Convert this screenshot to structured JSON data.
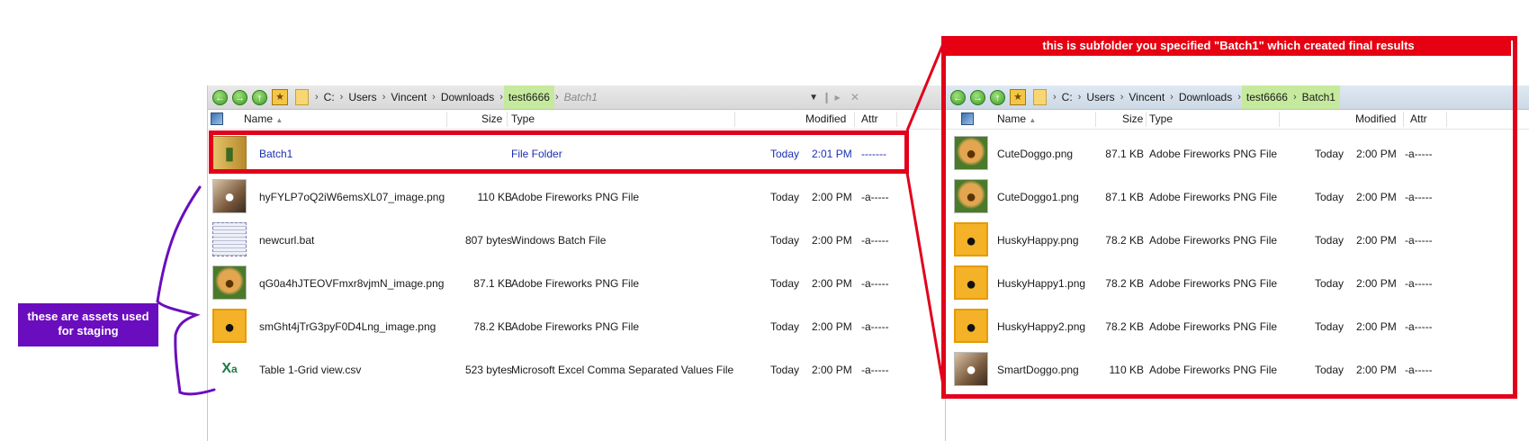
{
  "left_pane": {
    "breadcrumbs": [
      "C:",
      "Users",
      "Vincent",
      "Downloads",
      "test6666",
      "Batch1"
    ],
    "columns": {
      "name": "Name",
      "size": "Size",
      "type": "Type",
      "modified": "Modified",
      "attr": "Attr"
    },
    "rows": [
      {
        "name": "Batch1",
        "size": "",
        "type": "File Folder",
        "date": "Today",
        "time": "2:01 PM",
        "attr": "-------",
        "thumb": "folder-icon"
      },
      {
        "name": "hyFYLP7oQ2iW6emsXL07_image.png",
        "size": "110 KB",
        "type": "Adobe Fireworks PNG File",
        "date": "Today",
        "time": "2:00 PM",
        "attr": "-a-----",
        "thumb": "pug-thumbnail"
      },
      {
        "name": "newcurl.bat",
        "size": "807 bytes",
        "type": "Windows Batch File",
        "date": "Today",
        "time": "2:00 PM",
        "attr": "-a-----",
        "thumb": "batch-file-icon"
      },
      {
        "name": "qG0a4hJTEOVFmxr8vjmN_image.png",
        "size": "87.1 KB",
        "type": "Adobe Fireworks PNG File",
        "date": "Today",
        "time": "2:00 PM",
        "attr": "-a-----",
        "thumb": "golden-puppy-thumbnail"
      },
      {
        "name": "smGht4jTrG3pyF0D4Lng_image.png",
        "size": "78.2 KB",
        "type": "Adobe Fireworks PNG File",
        "date": "Today",
        "time": "2:00 PM",
        "attr": "-a-----",
        "thumb": "husky-thumbnail"
      },
      {
        "name": "Table 1-Grid view.csv",
        "size": "523 bytes",
        "type": "Microsoft Excel Comma Separated Values File",
        "date": "Today",
        "time": "2:00 PM",
        "attr": "-a-----",
        "thumb": "excel-csv-icon"
      }
    ]
  },
  "right_pane": {
    "breadcrumbs": [
      "C:",
      "Users",
      "Vincent",
      "Downloads",
      "test6666",
      "Batch1"
    ],
    "columns": {
      "name": "Name",
      "size": "Size",
      "type": "Type",
      "modified": "Modified",
      "attr": "Attr"
    },
    "rows": [
      {
        "name": "CuteDoggo.png",
        "size": "87.1 KB",
        "type": "Adobe Fireworks PNG File",
        "date": "Today",
        "time": "2:00 PM",
        "attr": "-a-----",
        "thumb": "golden-puppy-thumbnail"
      },
      {
        "name": "CuteDoggo1.png",
        "size": "87.1 KB",
        "type": "Adobe Fireworks PNG File",
        "date": "Today",
        "time": "2:00 PM",
        "attr": "-a-----",
        "thumb": "golden-puppy-thumbnail"
      },
      {
        "name": "HuskyHappy.png",
        "size": "78.2 KB",
        "type": "Adobe Fireworks PNG File",
        "date": "Today",
        "time": "2:00 PM",
        "attr": "-a-----",
        "thumb": "husky-thumbnail"
      },
      {
        "name": "HuskyHappy1.png",
        "size": "78.2 KB",
        "type": "Adobe Fireworks PNG File",
        "date": "Today",
        "time": "2:00 PM",
        "attr": "-a-----",
        "thumb": "husky-thumbnail"
      },
      {
        "name": "HuskyHappy2.png",
        "size": "78.2 KB",
        "type": "Adobe Fireworks PNG File",
        "date": "Today",
        "time": "2:00 PM",
        "attr": "-a-----",
        "thumb": "husky-thumbnail"
      },
      {
        "name": "SmartDoggo.png",
        "size": "110 KB",
        "type": "Adobe Fireworks PNG File",
        "date": "Today",
        "time": "2:00 PM",
        "attr": "-a-----",
        "thumb": "pug-thumbnail"
      }
    ]
  },
  "annotations": {
    "banner": "this is subfolder you specified \"Batch1\" which created final results",
    "staging_note": "these are assets used for staging",
    "highlight_color": "#e2001a",
    "note_color": "#6a0dbe"
  }
}
